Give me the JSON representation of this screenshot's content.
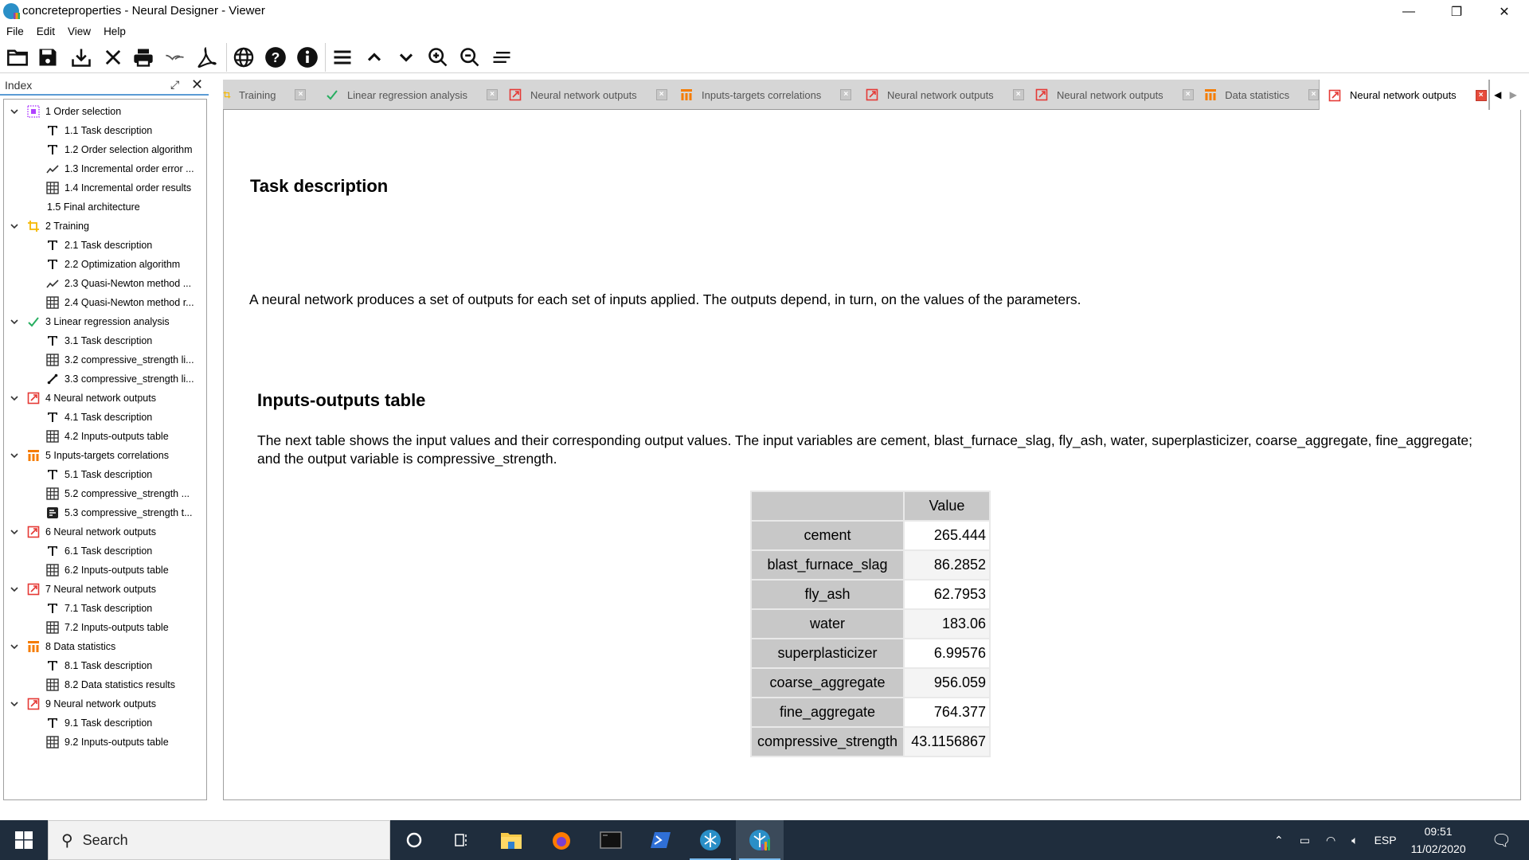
{
  "window": {
    "title": "concreteproperties - Neural Designer - Viewer",
    "controls": {
      "minimize": "—",
      "restore": "❐",
      "close": "✕"
    }
  },
  "menu": [
    "File",
    "Edit",
    "View",
    "Help"
  ],
  "toolbar": [
    {
      "name": "open-icon"
    },
    {
      "name": "save-icon"
    },
    {
      "name": "import-icon"
    },
    {
      "name": "close-icon"
    },
    {
      "name": "print-icon"
    },
    {
      "name": "export-openoffice-icon"
    },
    {
      "name": "export-pdf-icon"
    },
    {
      "name": "globe-icon"
    },
    {
      "name": "help-icon"
    },
    {
      "name": "info-icon"
    },
    {
      "name": "menu-icon"
    },
    {
      "name": "chevron-up-icon"
    },
    {
      "name": "chevron-down-icon"
    },
    {
      "name": "zoom-in-icon"
    },
    {
      "name": "zoom-out-icon"
    },
    {
      "name": "align-icon"
    }
  ],
  "index": {
    "title": "Index",
    "items": [
      {
        "level": 0,
        "label": "1 Order selection",
        "icon": "order-selection",
        "expanded": true
      },
      {
        "level": 1,
        "label": "1.1 Task description",
        "icon": "text"
      },
      {
        "level": 1,
        "label": "1.2 Order selection algorithm",
        "icon": "text"
      },
      {
        "level": 1,
        "label": "1.3 Incremental order error ...",
        "icon": "line-chart"
      },
      {
        "level": 1,
        "label": "1.4 Incremental order results",
        "icon": "table"
      },
      {
        "level": 1,
        "label": "1.5 Final architecture",
        "icon": "none"
      },
      {
        "level": 0,
        "label": "2 Training",
        "icon": "training",
        "expanded": true
      },
      {
        "level": 1,
        "label": "2.1 Task description",
        "icon": "text"
      },
      {
        "level": 1,
        "label": "2.2 Optimization algorithm",
        "icon": "text"
      },
      {
        "level": 1,
        "label": "2.3 Quasi-Newton method ...",
        "icon": "line-chart"
      },
      {
        "level": 1,
        "label": "2.4 Quasi-Newton method r...",
        "icon": "table"
      },
      {
        "level": 0,
        "label": "3 Linear regression analysis",
        "icon": "check",
        "expanded": true
      },
      {
        "level": 1,
        "label": "3.1 Task description",
        "icon": "text"
      },
      {
        "level": 1,
        "label": "3.2 compressive_strength li...",
        "icon": "table"
      },
      {
        "level": 1,
        "label": "3.3 compressive_strength li...",
        "icon": "scatter"
      },
      {
        "level": 0,
        "label": "4 Neural network outputs",
        "icon": "nn-outputs",
        "expanded": true
      },
      {
        "level": 1,
        "label": "4.1 Task description",
        "icon": "text"
      },
      {
        "level": 1,
        "label": "4.2 Inputs-outputs table",
        "icon": "table"
      },
      {
        "level": 0,
        "label": "5 Inputs-targets correlations",
        "icon": "correlations",
        "expanded": true
      },
      {
        "level": 1,
        "label": "5.1 Task description",
        "icon": "text"
      },
      {
        "level": 1,
        "label": "5.2 compressive_strength ...",
        "icon": "table"
      },
      {
        "level": 1,
        "label": "5.3 compressive_strength t...",
        "icon": "bar-chart"
      },
      {
        "level": 0,
        "label": "6 Neural network outputs",
        "icon": "nn-outputs",
        "expanded": true
      },
      {
        "level": 1,
        "label": "6.1 Task description",
        "icon": "text"
      },
      {
        "level": 1,
        "label": "6.2 Inputs-outputs table",
        "icon": "table"
      },
      {
        "level": 0,
        "label": "7 Neural network outputs",
        "icon": "nn-outputs",
        "expanded": true
      },
      {
        "level": 1,
        "label": "7.1 Task description",
        "icon": "text"
      },
      {
        "level": 1,
        "label": "7.2 Inputs-outputs table",
        "icon": "table"
      },
      {
        "level": 0,
        "label": "8 Data statistics",
        "icon": "correlations",
        "expanded": true
      },
      {
        "level": 1,
        "label": "8.1 Task description",
        "icon": "text"
      },
      {
        "level": 1,
        "label": "8.2 Data statistics results",
        "icon": "table"
      },
      {
        "level": 0,
        "label": "9 Neural network outputs",
        "icon": "nn-outputs",
        "expanded": true
      },
      {
        "level": 1,
        "label": "9.1 Task description",
        "icon": "text"
      },
      {
        "level": 1,
        "label": "9.2 Inputs-outputs table",
        "icon": "table"
      }
    ]
  },
  "tabs": [
    {
      "label": "Training",
      "icon": "training",
      "active": false
    },
    {
      "label": "Linear regression analysis",
      "icon": "check",
      "active": false
    },
    {
      "label": "Neural network outputs",
      "icon": "nn-outputs",
      "active": false
    },
    {
      "label": "Inputs-targets correlations",
      "icon": "correlations",
      "active": false
    },
    {
      "label": "Neural network outputs",
      "icon": "nn-outputs",
      "active": false
    },
    {
      "label": "Neural network outputs",
      "icon": "nn-outputs",
      "active": false
    },
    {
      "label": "Data statistics",
      "icon": "correlations",
      "active": false
    },
    {
      "label": "Neural network outputs",
      "icon": "nn-outputs",
      "active": true
    }
  ],
  "content": {
    "task_heading": "Task description",
    "task_text": "A neural network produces a set of outputs for each set of inputs applied. The outputs depend, in turn, on the values of the parameters.",
    "table_heading": "Inputs-outputs table",
    "table_text": "The next table shows the input values and their corresponding output values. The input variables are cement, blast_furnace_slag, fly_ash, water, superplasticizer, coarse_aggregate, fine_aggregate; and the output variable is compressive_strength.",
    "table": {
      "header": "Value",
      "rows": [
        {
          "name": "cement",
          "value": "265.444"
        },
        {
          "name": "blast_furnace_slag",
          "value": "86.2852"
        },
        {
          "name": "fly_ash",
          "value": "62.7953"
        },
        {
          "name": "water",
          "value": "183.06"
        },
        {
          "name": "superplasticizer",
          "value": "6.99576"
        },
        {
          "name": "coarse_aggregate",
          "value": "956.059"
        },
        {
          "name": "fine_aggregate",
          "value": "764.377"
        },
        {
          "name": "compressive_strength",
          "value": "43.1156867"
        }
      ]
    }
  },
  "taskbar": {
    "search_placeholder": "Search",
    "apps": [
      "cortana",
      "task-view",
      "file-explorer",
      "firefox",
      "terminal",
      "powershell",
      "neural-designer",
      "neural-designer-viewer"
    ],
    "language": "ESP",
    "time": "09:51",
    "date": "11/02/2020"
  },
  "colors": {
    "nn_outputs_red": "#e53935",
    "correlations_orange": "#f57c00",
    "check_green": "#27ae60",
    "order_purple": "#b042ff",
    "training_yellow": "#f5b800",
    "taskbar_bg": "#1f2d3d"
  }
}
